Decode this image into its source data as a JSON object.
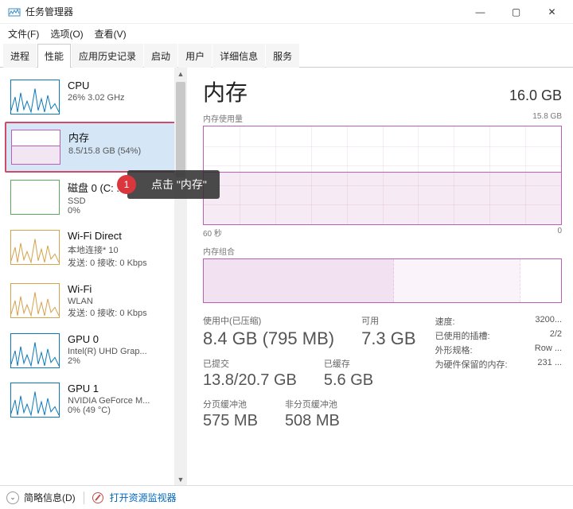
{
  "window": {
    "title": "任务管理器",
    "min": "—",
    "max": "▢",
    "close": "✕"
  },
  "menu": {
    "file": "文件(F)",
    "options": "选项(O)",
    "view": "查看(V)"
  },
  "tabs": {
    "processes": "进程",
    "performance": "性能",
    "app_history": "应用历史记录",
    "startup": "启动",
    "users": "用户",
    "details": "详细信息",
    "services": "服务"
  },
  "sidebar": [
    {
      "title": "CPU",
      "sub": "26%  3.02 GHz",
      "sub2": "",
      "kind": "cpu"
    },
    {
      "title": "内存",
      "sub": "8.5/15.8 GB (54%)",
      "sub2": "",
      "kind": "mem",
      "selected": true
    },
    {
      "title": "磁盘 0 (C: ...)",
      "sub": "SSD",
      "sub2": "0%",
      "kind": "disk"
    },
    {
      "title": "Wi-Fi Direct",
      "sub": "本地连接* 10",
      "sub2": "发送: 0  接收: 0 Kbps",
      "kind": "wifi"
    },
    {
      "title": "Wi-Fi",
      "sub": "WLAN",
      "sub2": "发送: 0  接收: 0 Kbps",
      "kind": "wifi"
    },
    {
      "title": "GPU 0",
      "sub": "Intel(R) UHD Grap...",
      "sub2": "2%",
      "kind": "gpu"
    },
    {
      "title": "GPU 1",
      "sub": "NVIDIA GeForce M...",
      "sub2": "0% (49 °C)",
      "kind": "gpu"
    }
  ],
  "main": {
    "title": "内存",
    "total": "16.0 GB",
    "chart1_label": "内存使用量",
    "chart1_max": "15.8 GB",
    "x_left": "60 秒",
    "x_right": "0",
    "comp_label": "内存组合"
  },
  "stats": {
    "in_use_lab": "使用中(已压缩)",
    "in_use_val": "8.4 GB (795 MB)",
    "avail_lab": "可用",
    "avail_val": "7.3 GB",
    "commit_lab": "已提交",
    "commit_val": "13.8/20.7 GB",
    "cached_lab": "已缓存",
    "cached_val": "5.6 GB",
    "paged_lab": "分页缓冲池",
    "paged_val": "575 MB",
    "nonpaged_lab": "非分页缓冲池",
    "nonpaged_val": "508 MB"
  },
  "right": {
    "speed_l": "速度:",
    "speed_v": "3200...",
    "slots_l": "已使用的插槽:",
    "slots_v": "2/2",
    "form_l": "外形规格:",
    "form_v": "Row ...",
    "hw_l": "为硬件保留的内存:",
    "hw_v": "231 ..."
  },
  "footer": {
    "brief": "简略信息(D)",
    "resmon": "打开资源监视器"
  },
  "annotation": {
    "badge": "1",
    "text": "点击 \"内存\""
  },
  "chart_data": {
    "type": "area",
    "title": "内存使用量",
    "x": {
      "label_left": "60 秒",
      "label_right": "0"
    },
    "ylim": [
      0,
      15.8
    ],
    "y_unit": "GB",
    "series": [
      {
        "name": "使用中",
        "values": [
          8.5,
          8.5,
          8.5,
          8.5,
          8.5,
          8.5,
          8.5,
          8.5,
          8.5,
          8.5,
          8.5,
          8.5,
          8.5,
          8.5,
          8.5,
          8.5,
          8.4,
          8.4,
          8.4,
          8.4
        ]
      }
    ],
    "composition": {
      "type": "stacked-bar",
      "total_gb": 15.8,
      "segments": [
        {
          "name": "使用中",
          "gb": 8.4
        },
        {
          "name": "已缓存",
          "gb": 5.6
        },
        {
          "name": "可用",
          "gb": 1.8
        }
      ]
    }
  }
}
